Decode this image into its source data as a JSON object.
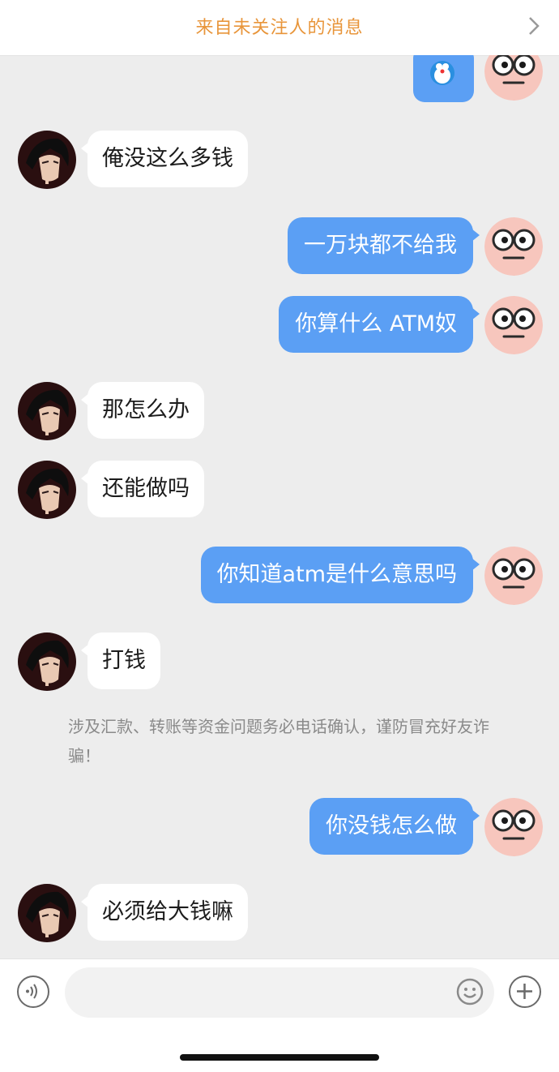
{
  "banner": {
    "title": "来自未关注人的消息"
  },
  "messages": [
    {
      "side": "in",
      "text": "俺没这么多钱"
    },
    {
      "side": "out",
      "text": "一万块都不给我"
    },
    {
      "side": "out",
      "text": "你算什么 ATM奴"
    },
    {
      "side": "in",
      "text": "那怎么办"
    },
    {
      "side": "in",
      "text": "还能做吗"
    },
    {
      "side": "out",
      "text": "你知道atm是什么意思吗"
    },
    {
      "side": "in",
      "text": "打钱"
    },
    {
      "side": "out",
      "text": "你没钱怎么做"
    },
    {
      "side": "in",
      "text": "必须给大钱嘛"
    }
  ],
  "notice": {
    "text": "涉及汇款、转账等资金问题务必电话确认，谨防冒充好友诈骗！"
  },
  "input": {
    "placeholder": ""
  },
  "colors": {
    "accent": "#e8953a",
    "outgoing_bubble": "#5b9ff4",
    "incoming_bubble": "#ffffff",
    "background": "#ededed"
  },
  "icons": {
    "voice": "voice-icon",
    "emoji": "emoji-icon",
    "add": "plus-icon",
    "back": "chevron-right-icon"
  }
}
